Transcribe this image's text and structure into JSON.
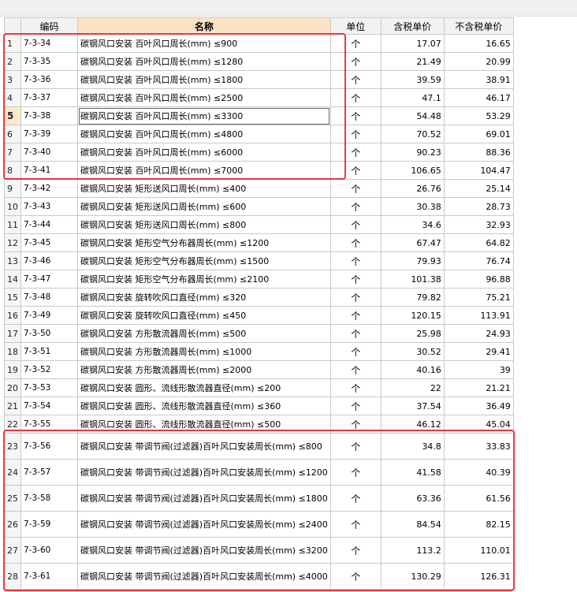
{
  "table": {
    "headers": [
      "",
      "编码",
      "名称",
      "单位",
      "含税单价",
      "不含税单价"
    ],
    "rows": [
      {
        "rn": "1",
        "code": "7-3-34",
        "name": "碳钢风口安装 百叶风口周长(mm) ≤900",
        "unit": "个",
        "tax": "17.07",
        "notax": "16.65"
      },
      {
        "rn": "2",
        "code": "7-3-35",
        "name": "碳钢风口安装 百叶风口周长(mm) ≤1280",
        "unit": "个",
        "tax": "21.49",
        "notax": "20.99"
      },
      {
        "rn": "3",
        "code": "7-3-36",
        "name": "碳钢风口安装 百叶风口周长(mm) ≤1800",
        "unit": "个",
        "tax": "39.59",
        "notax": "38.91"
      },
      {
        "rn": "4",
        "code": "7-3-37",
        "name": "碳钢风口安装 百叶风口周长(mm) ≤2500",
        "unit": "个",
        "tax": "47.1",
        "notax": "46.17"
      },
      {
        "rn": "5",
        "code": "7-3-38",
        "name": "碳钢风口安装 百叶风口周长(mm) ≤3300",
        "unit": "个",
        "tax": "54.48",
        "notax": "53.29"
      },
      {
        "rn": "6",
        "code": "7-3-39",
        "name": "碳钢风口安装 百叶风口周长(mm) ≤4800",
        "unit": "个",
        "tax": "70.52",
        "notax": "69.01"
      },
      {
        "rn": "7",
        "code": "7-3-40",
        "name": "碳钢风口安装 百叶风口周长(mm) ≤6000",
        "unit": "个",
        "tax": "90.23",
        "notax": "88.36"
      },
      {
        "rn": "8",
        "code": "7-3-41",
        "name": "碳钢风口安装 百叶风口周长(mm) ≤7000",
        "unit": "个",
        "tax": "106.65",
        "notax": "104.47"
      },
      {
        "rn": "9",
        "code": "7-3-42",
        "name": "碳钢风口安装 矩形送风口周长(mm) ≤400",
        "unit": "个",
        "tax": "26.76",
        "notax": "25.14"
      },
      {
        "rn": "10",
        "code": "7-3-43",
        "name": "碳钢风口安装 矩形送风口周长(mm) ≤600",
        "unit": "个",
        "tax": "30.38",
        "notax": "28.73"
      },
      {
        "rn": "11",
        "code": "7-3-44",
        "name": "碳钢风口安装 矩形送风口周长(mm) ≤800",
        "unit": "个",
        "tax": "34.6",
        "notax": "32.93"
      },
      {
        "rn": "12",
        "code": "7-3-45",
        "name": "碳钢风口安装 矩形空气分布器周长(mm) ≤1200",
        "unit": "个",
        "tax": "67.47",
        "notax": "64.82"
      },
      {
        "rn": "13",
        "code": "7-3-46",
        "name": "碳钢风口安装 矩形空气分布器周长(mm) ≤1500",
        "unit": "个",
        "tax": "79.93",
        "notax": "76.74"
      },
      {
        "rn": "14",
        "code": "7-3-47",
        "name": "碳钢风口安装 矩形空气分布器周长(mm) ≤2100",
        "unit": "个",
        "tax": "101.38",
        "notax": "96.88"
      },
      {
        "rn": "15",
        "code": "7-3-48",
        "name": "碳钢风口安装 旋转吹风口直径(mm) ≤320",
        "unit": "个",
        "tax": "79.82",
        "notax": "75.21"
      },
      {
        "rn": "16",
        "code": "7-3-49",
        "name": "碳钢风口安装 旋转吹风口直径(mm) ≤450",
        "unit": "个",
        "tax": "120.15",
        "notax": "113.91"
      },
      {
        "rn": "17",
        "code": "7-3-50",
        "name": "碳钢风口安装 方形散流器周长(mm) ≤500",
        "unit": "个",
        "tax": "25.98",
        "notax": "24.93"
      },
      {
        "rn": "18",
        "code": "7-3-51",
        "name": "碳钢风口安装 方形散流器周长(mm) ≤1000",
        "unit": "个",
        "tax": "30.52",
        "notax": "29.41"
      },
      {
        "rn": "19",
        "code": "7-3-52",
        "name": "碳钢风口安装 方形散流器周长(mm) ≤2000",
        "unit": "个",
        "tax": "40.16",
        "notax": "39"
      },
      {
        "rn": "20",
        "code": "7-3-53",
        "name": "碳钢风口安装 圆形、流线形散流器直径(mm) ≤200",
        "unit": "个",
        "tax": "22",
        "notax": "21.21"
      },
      {
        "rn": "21",
        "code": "7-3-54",
        "name": "碳钢风口安装 圆形、流线形散流器直径(mm) ≤360",
        "unit": "个",
        "tax": "37.54",
        "notax": "36.49"
      },
      {
        "rn": "22",
        "code": "7-3-55",
        "name": "碳钢风口安装 圆形、流线形散流器直径(mm) ≤500",
        "unit": "个",
        "tax": "46.12",
        "notax": "45.04"
      },
      {
        "rn": "23",
        "code": "7-3-56",
        "name": "碳钢风口安装 带调节阀(过滤器)百叶风口安装周长(mm) ≤800",
        "unit": "个",
        "tax": "34.8",
        "notax": "33.83"
      },
      {
        "rn": "24",
        "code": "7-3-57",
        "name": "碳钢风口安装 带调节阀(过滤器)百叶风口安装周长(mm) ≤1200",
        "unit": "个",
        "tax": "41.58",
        "notax": "40.39"
      },
      {
        "rn": "25",
        "code": "7-3-58",
        "name": "碳钢风口安装 带调节阀(过滤器)百叶风口安装周长(mm) ≤1800",
        "unit": "个",
        "tax": "63.36",
        "notax": "61.56"
      },
      {
        "rn": "26",
        "code": "7-3-59",
        "name": "碳钢风口安装 带调节阀(过滤器)百叶风口安装周长(mm) ≤2400",
        "unit": "个",
        "tax": "84.54",
        "notax": "82.15"
      },
      {
        "rn": "27",
        "code": "7-3-60",
        "name": "碳钢风口安装 带调节阀(过滤器)百叶风口安装周长(mm) ≤3200",
        "unit": "个",
        "tax": "113.2",
        "notax": "110.01"
      },
      {
        "rn": "28",
        "code": "7-3-61",
        "name": "碳钢风口安装 带调节阀(过滤器)百叶风口安装周长(mm) ≤4000",
        "unit": "个",
        "tax": "130.29",
        "notax": "126.31"
      }
    ]
  },
  "selected_row": "5",
  "colors": {
    "highlight_box": "#e8383d",
    "name_header_bg": "#fbe3c6",
    "selected_row_header_bg": "#fde9c8"
  }
}
